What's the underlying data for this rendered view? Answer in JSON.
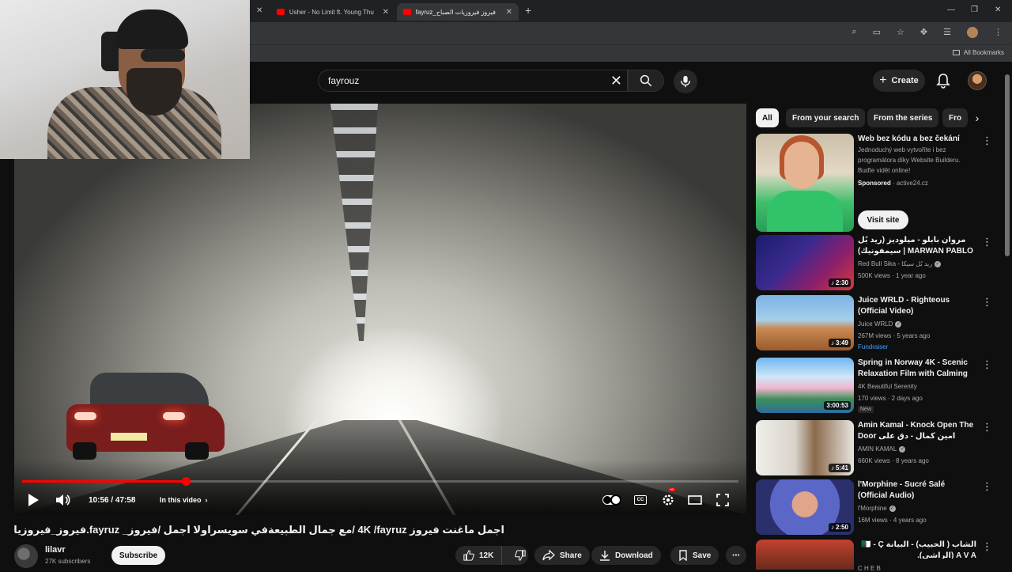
{
  "browser": {
    "tabs": [
      {
        "title": "Usher - No Limit ft. Young Thu",
        "active": false
      },
      {
        "title": "fayruz_فيروز فيروزيات الصباح",
        "active": true
      }
    ],
    "bookmarks_label": "All Bookmarks"
  },
  "header": {
    "search_value": "fayrouz",
    "create_label": "Create"
  },
  "player": {
    "current_time": "10:56",
    "duration": "47:58",
    "time_display": "10:56 / 47:58",
    "progress": 0.228,
    "chapter_label": "In this video"
  },
  "video": {
    "title": "اجمل ماغنت فيروز 4K /fayruz /مع جمال الطبيعةفي سويسراولا اجمل /فيروز_ fayruz.فيروز_فيروزيات الصباح",
    "channel": "lilavr",
    "subscribers": "27K subscribers",
    "subscribe_label": "Subscribe",
    "likes": "12K",
    "share_label": "Share",
    "download_label": "Download",
    "save_label": "Save"
  },
  "chips": [
    {
      "label": "All",
      "active": true
    },
    {
      "label": "From your search",
      "active": false
    },
    {
      "label": "From the series",
      "active": false
    },
    {
      "label": "Fro",
      "active": false
    }
  ],
  "ad": {
    "title": "Web bez kódu a bez čekání",
    "description": "Jednoduchý web vytvoříte i bez programátora díky Website Builderu. Buďte vidět online!",
    "sponsored": "Sponsored",
    "domain": "· active24.cz",
    "cta": "Visit site"
  },
  "recommendations": [
    {
      "title": "مروان بابلو - ميلوديز (ريد بُل سيمفونيك) | MARWAN PABLO - MELODIES ...",
      "channel": "Red Bull Sika - ريد بُل سيكا",
      "meta": "500K views · 1 year ago",
      "duration": "2:30",
      "badge": ""
    },
    {
      "title": "Juice WRLD - Righteous (Official Video)",
      "channel": "Juice WRLD",
      "meta": "267M views · 5 years ago",
      "duration": "3:49",
      "badge": "Fundraiser"
    },
    {
      "title": "Spring in Norway 4K - Scenic Relaxation Film with Calming ...",
      "channel": "4K Beautiful Serenity",
      "meta": "170 views · 2 days ago",
      "duration": "3:00:53",
      "badge": "New"
    },
    {
      "title": "Amin Kamal - Knock Open The Door امين كمال - دق على الباب",
      "channel": "AMIN KAMAL",
      "meta": "660K views · 8 years ago",
      "duration": "5:41",
      "badge": ""
    },
    {
      "title": "l'Morphine - Sucré Salé (Official Audio)",
      "channel": "l'Morphine",
      "meta": "16M views · 4 years ago",
      "duration": "2:50",
      "badge": ""
    },
    {
      "title": "الشاب ( الحبيب) - البيانة 🇩🇿 - Ç A V A (الراشي).",
      "channel": "C H E B",
      "meta": "",
      "duration": "",
      "badge": ""
    }
  ]
}
